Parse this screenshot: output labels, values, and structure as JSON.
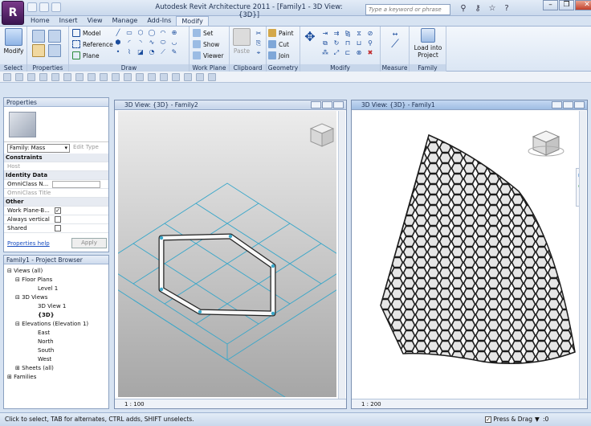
{
  "window": {
    "title": "Autodesk Revit Architecture 2011 - [Family1 - 3D View: {3D}]"
  },
  "app_button": {
    "label": "R"
  },
  "search": {
    "placeholder": "Type a keyword or phrase"
  },
  "tabs": [
    {
      "label": "Home"
    },
    {
      "label": "Insert"
    },
    {
      "label": "View"
    },
    {
      "label": "Manage"
    },
    {
      "label": "Add-Ins"
    },
    {
      "label": "Modify"
    }
  ],
  "ribbon": {
    "select": {
      "button": "Modify",
      "label": "Select"
    },
    "properties": {
      "label": "Properties"
    },
    "draw": {
      "label": "Draw",
      "model": "Model",
      "reference": "Reference",
      "plane": "Plane"
    },
    "workplane": {
      "label": "Work Plane",
      "set": "Set",
      "show": "Show",
      "viewer": "Viewer"
    },
    "clipboard": {
      "label": "Clipboard",
      "paste": "Paste"
    },
    "geometry": {
      "label": "Geometry",
      "paint": "Paint",
      "cut": "Cut",
      "join": "Join"
    },
    "modify": {
      "label": "Modify"
    },
    "measure": {
      "label": "Measure"
    },
    "family_editor": {
      "label": "Family Editor",
      "load": "Load into Project"
    }
  },
  "properties_panel": {
    "title": "Properties",
    "family_type": "Family: Mass",
    "edit_type": "Edit Type",
    "sections": {
      "constraints": "Constraints",
      "identity": "Identity Data",
      "other": "Other"
    },
    "rows": {
      "host": "Host",
      "omniclass_n": "OmniClass N...",
      "omniclass_title": "OmniClass Title",
      "work_plane": "Work Plane-B...",
      "always_vertical": "Always vertical",
      "shared": "Shared"
    },
    "help": "Properties help",
    "apply": "Apply"
  },
  "project_browser": {
    "title": "Family1 - Project Browser",
    "nodes": {
      "views": "Views (all)",
      "floor_plans": "Floor Plans",
      "level1": "Level 1",
      "views3d": "3D Views",
      "view1": "3D View 1",
      "view3d": "{3D}",
      "elevations": "Elevations (Elevation 1)",
      "east": "East",
      "north": "North",
      "south": "South",
      "west": "West",
      "sheets": "Sheets (all)",
      "families": "Families"
    }
  },
  "view_left": {
    "title": "3D View: {3D} - Family2",
    "scale": "1 : 100"
  },
  "view_right": {
    "title": "3D View: {3D} - Family1",
    "scale": "1 : 200"
  },
  "status": {
    "message": "Click to select, TAB for alternates, CTRL adds, SHIFT unselects.",
    "press_drag": "Press & Drag",
    "filter_count": ":0"
  },
  "colors": {
    "accent": "#1d2f4f",
    "ribbon_bg": "#dbe6f4",
    "grid_line": "#3aa7c9",
    "viewport_gray": "#b0b0b0"
  }
}
